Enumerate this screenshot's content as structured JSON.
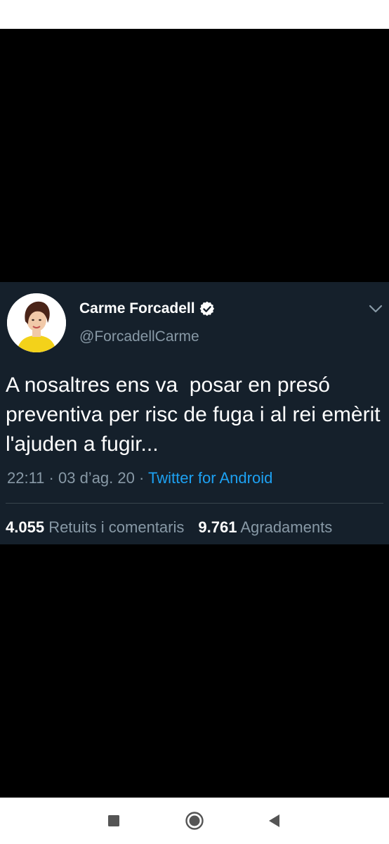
{
  "tweet": {
    "display_name": "Carme Forcadell",
    "handle": "@ForcadellCarme",
    "text": "A nosaltres ens va  posar en presó preventiva per risc de fuga i al rei emèrit l'ajuden a fugir...",
    "time": "22:11",
    "separator_1": " · ",
    "date": "03 d’ag. 20",
    "separator_2": " · ",
    "source": "Twitter for Android",
    "retweets_count": "4.055",
    "retweets_label": "Retuits i comentaris",
    "likes_count": "9.761",
    "likes_label": "Agradaments",
    "icons": [
      "avatar",
      "verified-badge-icon",
      "chevron-down-icon"
    ]
  },
  "navigation": {
    "buttons": [
      "recents-square-icon",
      "home-circle-icon",
      "back-triangle-icon"
    ]
  },
  "colors": {
    "tweet_background": "#15202b",
    "secondary_text": "#8899a6",
    "link": "#1da1f2",
    "divider": "#38444d"
  }
}
